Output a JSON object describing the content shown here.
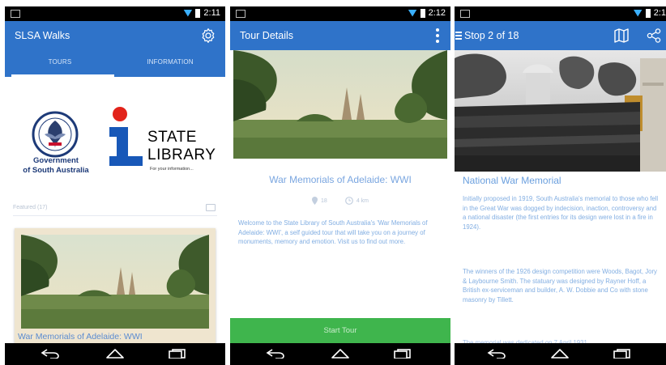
{
  "screen1": {
    "status_time": "2:11",
    "appbar_title": "SLSA Walks",
    "tabs": [
      {
        "label": "TOURS"
      },
      {
        "label": "INFORMATION"
      }
    ],
    "gov_logo_text": [
      "Government",
      "of South Australia"
    ],
    "library_logo_text": [
      "STATE",
      "LIBRARY"
    ],
    "library_tagline": "For your information...",
    "filter_label": "Featured (17)",
    "card_title": "War Memorials of Adelaide: WWI"
  },
  "screen2": {
    "status_time": "2:12",
    "appbar_title": "Tour Details",
    "tour_title": "War Memorials of Adelaide: WWI",
    "meta": [
      {
        "value": "18"
      },
      {
        "value": "4 km"
      }
    ],
    "description": "Welcome to the State Library of South Australia's 'War Memorials of Adelaide: WWI', a self guided tour that will take you on a journey of monuments, memory and emotion. Visit us to find out more.",
    "start_button": "Start Tour"
  },
  "screen3": {
    "status_time": "2:1",
    "appbar_title": "Stop 2 of 18",
    "stop_title": "National War Memorial",
    "para1": "Initially proposed in 1919, South Australia's memorial to those who fell in the Great War was dogged by indecision, inaction, controversy and a national disaster (the first entries for its design were lost in a fire in 1924).",
    "para2": "The winners of the 1926 design competition were Woods, Bagot, Jory & Laybourne Smith. The statuary was designed by Rayner Hoff, a British ex-serviceman and builder, A. W. Dobbie and Co with stone masonry by Tillett.",
    "para3": "The memorial was dedicated on 7 April 1931"
  },
  "colors": {
    "app_bar": "#2f73c9",
    "accent_text": "#7aa6e0",
    "start_button": "#3fb54d",
    "status_bar": "#000000"
  },
  "icons": {
    "settings": "gear-icon",
    "overflow": "kebab-menu-icon",
    "drawer": "hamburger-menu-icon",
    "map": "map-icon",
    "share": "share-icon",
    "back": "back-arrow-icon",
    "home": "home-icon",
    "recents": "recents-icon"
  }
}
